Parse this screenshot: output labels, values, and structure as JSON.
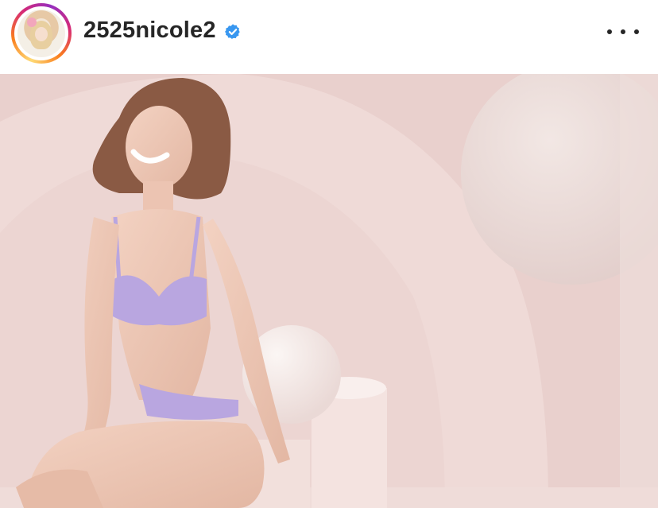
{
  "header": {
    "username": "2525nicole2",
    "verified_icon": "verified-badge-icon",
    "more_icon": "more-options-icon"
  },
  "colors": {
    "verified_blue": "#3897f0",
    "text": "#262626",
    "photo_bg": "#e9cfcc",
    "lingerie": "#b9a6e0"
  }
}
